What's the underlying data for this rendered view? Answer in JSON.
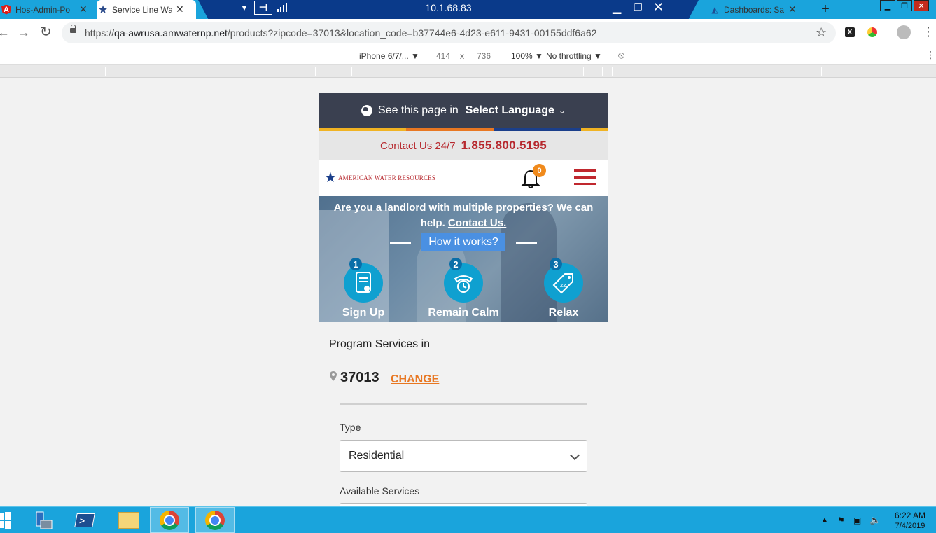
{
  "tabs": [
    {
      "title": "Hos-Admin-Po",
      "close": "✕"
    },
    {
      "title": "Service Line Wa",
      "close": "✕"
    },
    {
      "title": "Dashboards: Sa",
      "close": "✕"
    }
  ],
  "new_tab": "+",
  "remote_desktop": {
    "title": "10.1.68.83",
    "min": "▁",
    "restore": "❐",
    "close": "✕"
  },
  "toolbar": {
    "url_scheme": "https://",
    "url_host": "qa-awrusa.amwaternp.net",
    "url_path": "/products?zipcode=37013&location_code=b37744e6-4d23-e611-9431-00155ddf6a62"
  },
  "device_toolbar": {
    "device": "iPhone 6/7/... ▼",
    "width": "414",
    "dim_separator": "x",
    "height": "736",
    "zoom": "100% ▼",
    "throttling": "No throttling ▼"
  },
  "page": {
    "language_prefix": "See this page in",
    "language_select": "Select Language",
    "contact_label": "Contact Us 24/7",
    "contact_phone": "1.855.800.5195",
    "logo_text": "AMERICAN WATER RESOURCES",
    "notification_count": "0",
    "hero_text": "Are you a landlord with multiple properties? We can help.",
    "hero_link": "Contact Us.",
    "how_it_works": "How it works?",
    "steps": [
      {
        "number": "1",
        "label": "Sign Up"
      },
      {
        "number": "2",
        "label": "Remain Calm"
      },
      {
        "number": "3",
        "label": "Relax"
      }
    ],
    "program_title": "Program Services in",
    "zipcode": "37013",
    "change_link": "CHANGE",
    "type_label": "Type",
    "type_value": "Residential",
    "available_services_label": "Available Services"
  },
  "colors": {
    "brand_red": "#b7282e",
    "accent_orange": "#e87722",
    "header_dark": "#3a4050",
    "step_blue": "#0fa0d0",
    "taskbar": "#1aa4dc",
    "stripe": [
      "#f0b323",
      "#e87722",
      "#1b3f8b",
      "#f0b323"
    ]
  },
  "taskbar": {
    "time": "6:22 AM",
    "date": "7/4/2019"
  }
}
